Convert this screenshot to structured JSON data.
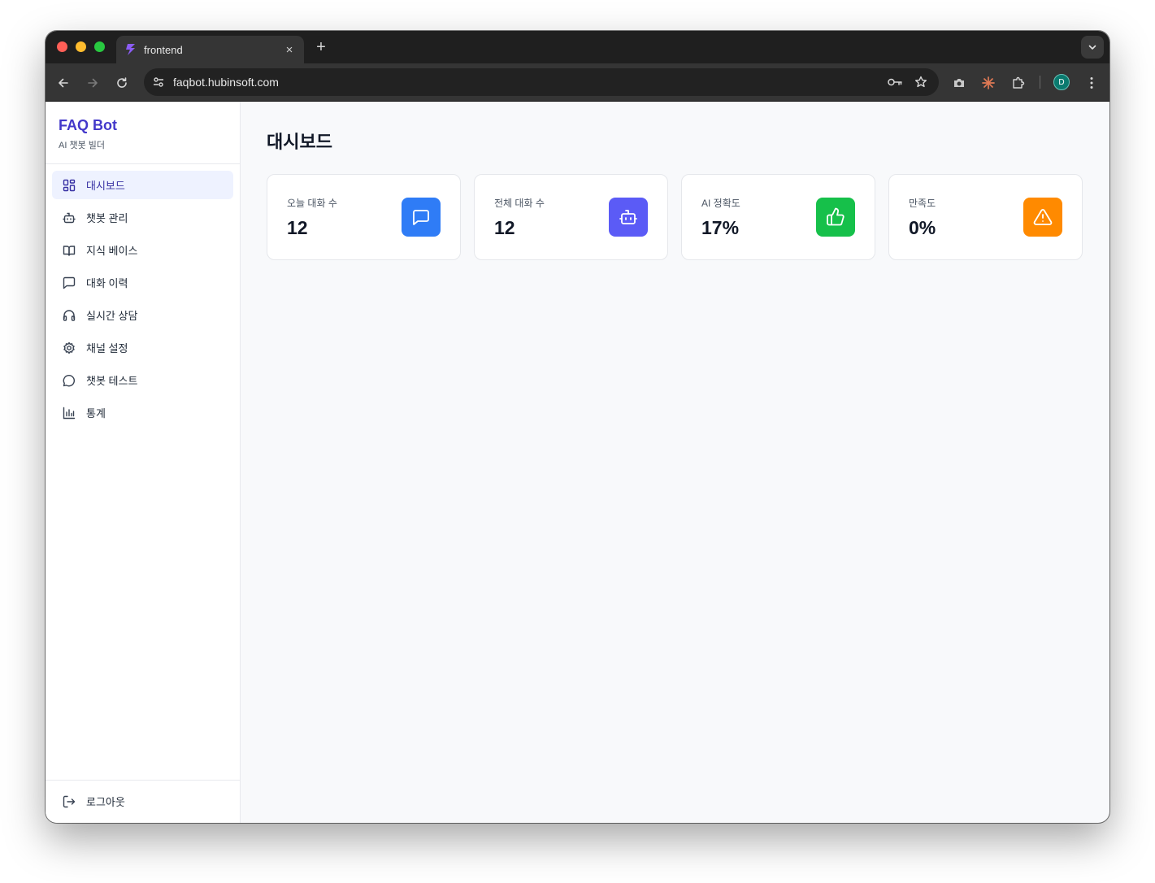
{
  "browser": {
    "tab_title": "frontend",
    "tab_close": "×",
    "new_tab": "+",
    "url": "faqbot.hubinsoft.com",
    "profile_initial": "D"
  },
  "sidebar": {
    "brand_title": "FAQ Bot",
    "brand_subtitle": "AI 챗봇 빌더",
    "items": [
      {
        "label": "대시보드",
        "icon": "dashboard-icon",
        "active": true
      },
      {
        "label": "챗봇 관리",
        "icon": "bot-icon"
      },
      {
        "label": "지식 베이스",
        "icon": "book-icon"
      },
      {
        "label": "대화 이력",
        "icon": "message-square-icon"
      },
      {
        "label": "실시간 상담",
        "icon": "headphones-icon"
      },
      {
        "label": "채널 설정",
        "icon": "gear-icon"
      },
      {
        "label": "챗봇 테스트",
        "icon": "message-circle-icon"
      },
      {
        "label": "통계",
        "icon": "bar-chart-icon"
      }
    ],
    "logout_label": "로그아웃"
  },
  "main": {
    "title": "대시보드",
    "cards": [
      {
        "label": "오늘 대화 수",
        "value": "12",
        "icon": "message-square-icon",
        "color": "#2f7cf6"
      },
      {
        "label": "전체 대화 수",
        "value": "12",
        "icon": "bot-icon",
        "color": "#5b5bf6"
      },
      {
        "label": "AI 정확도",
        "value": "17%",
        "icon": "thumbs-up-icon",
        "color": "#16c04a"
      },
      {
        "label": "만족도",
        "value": "0%",
        "icon": "alert-triangle-icon",
        "color": "#ff8a00"
      }
    ]
  },
  "colors": {
    "accent": "#4338ca",
    "active_nav_bg": "#eef2ff"
  }
}
